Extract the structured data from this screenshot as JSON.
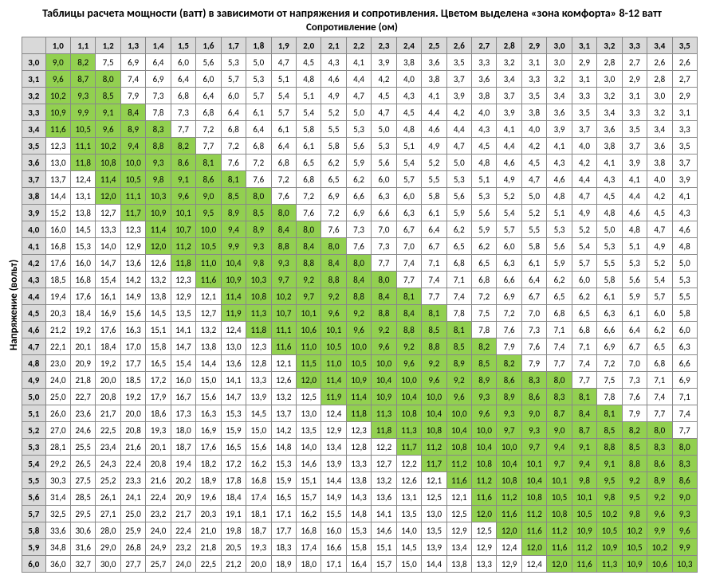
{
  "title": "Таблицы расчета мощности (ватт) в зависимоти от напряжения и сопротивления. Цветом выделена «зона комфорта» 8-12 ватт",
  "subtitle": "Сопротивление (ом)",
  "side_label": "Напряжение (вольт)",
  "comfort_min": 8.0,
  "comfort_max": 12.0,
  "chart_data": {
    "type": "table",
    "title": "Power (W) = Voltage² / Resistance",
    "xlabel": "Сопротивление (ом)",
    "ylabel": "Напряжение (вольт)",
    "resistance": [
      "1,0",
      "1,1",
      "1,2",
      "1,3",
      "1,4",
      "1,5",
      "1,6",
      "1,7",
      "1,8",
      "1,9",
      "2,0",
      "2,1",
      "2,2",
      "2,3",
      "2,4",
      "2,5",
      "2,6",
      "2,7",
      "2,8",
      "2,9",
      "3,0",
      "3,1",
      "3,2",
      "3,3",
      "3,4",
      "3,5"
    ],
    "voltage": [
      "3,0",
      "3,1",
      "3,2",
      "3,3",
      "3,4",
      "3,5",
      "3,6",
      "3,7",
      "3,8",
      "3,9",
      "4,0",
      "4,1",
      "4,2",
      "4,3",
      "4,4",
      "4,5",
      "4,6",
      "4,7",
      "4,8",
      "4,9",
      "5,0",
      "5,1",
      "5,2",
      "5,3",
      "5,4",
      "5,5",
      "5,6",
      "5,7",
      "5,8",
      "5,9",
      "6,0"
    ],
    "values": [
      [
        "9,0",
        "8,2",
        "7,5",
        "6,9",
        "6,4",
        "6,0",
        "5,6",
        "5,3",
        "5,0",
        "4,7",
        "4,5",
        "4,3",
        "4,1",
        "3,9",
        "3,8",
        "3,6",
        "3,5",
        "3,3",
        "3,2",
        "3,1",
        "3,0",
        "2,9",
        "2,8",
        "2,7",
        "2,6",
        "2,6"
      ],
      [
        "9,6",
        "8,7",
        "8,0",
        "7,4",
        "6,9",
        "6,4",
        "6,0",
        "5,7",
        "5,3",
        "5,1",
        "4,8",
        "4,6",
        "4,4",
        "4,2",
        "4,0",
        "3,8",
        "3,7",
        "3,6",
        "3,4",
        "3,3",
        "3,2",
        "3,1",
        "3,0",
        "2,9",
        "2,8",
        "2,7"
      ],
      [
        "10,2",
        "9,3",
        "8,5",
        "7,9",
        "7,3",
        "6,8",
        "6,4",
        "6,0",
        "5,7",
        "5,4",
        "5,1",
        "4,9",
        "4,7",
        "4,5",
        "4,3",
        "4,1",
        "3,9",
        "3,8",
        "3,7",
        "3,5",
        "3,4",
        "3,3",
        "3,2",
        "3,1",
        "3,0",
        "2,9"
      ],
      [
        "10,9",
        "9,9",
        "9,1",
        "8,4",
        "7,8",
        "7,3",
        "6,8",
        "6,4",
        "6,1",
        "5,7",
        "5,4",
        "5,2",
        "5,0",
        "4,7",
        "4,5",
        "4,4",
        "4,2",
        "4,0",
        "3,9",
        "3,8",
        "3,6",
        "3,5",
        "3,4",
        "3,3",
        "3,2",
        "3,1"
      ],
      [
        "11,6",
        "10,5",
        "9,6",
        "8,9",
        "8,3",
        "7,7",
        "7,2",
        "6,8",
        "6,4",
        "6,1",
        "5,8",
        "5,5",
        "5,3",
        "5,0",
        "4,8",
        "4,6",
        "4,4",
        "4,3",
        "4,1",
        "4,0",
        "3,9",
        "3,7",
        "3,6",
        "3,5",
        "3,4",
        "3,3"
      ],
      [
        "12,3",
        "11,1",
        "10,2",
        "9,4",
        "8,8",
        "8,2",
        "7,7",
        "7,2",
        "6,8",
        "6,4",
        "6,1",
        "5,8",
        "5,6",
        "5,3",
        "5,1",
        "4,9",
        "4,7",
        "4,5",
        "4,4",
        "4,2",
        "4,1",
        "4,0",
        "3,8",
        "3,7",
        "3,6",
        "3,5"
      ],
      [
        "13,0",
        "11,8",
        "10,8",
        "10,0",
        "9,3",
        "8,6",
        "8,1",
        "7,6",
        "7,2",
        "6,8",
        "6,5",
        "6,2",
        "5,9",
        "5,6",
        "5,4",
        "5,2",
        "5,0",
        "4,8",
        "4,6",
        "4,5",
        "4,3",
        "4,2",
        "4,1",
        "3,9",
        "3,8",
        "3,7"
      ],
      [
        "13,7",
        "12,4",
        "11,4",
        "10,5",
        "9,8",
        "9,1",
        "8,6",
        "8,1",
        "7,6",
        "7,2",
        "6,8",
        "6,5",
        "6,2",
        "6,0",
        "5,7",
        "5,5",
        "5,3",
        "5,1",
        "4,9",
        "4,7",
        "4,6",
        "4,4",
        "4,3",
        "4,1",
        "4,0",
        "3,9"
      ],
      [
        "14,4",
        "13,1",
        "12,0",
        "11,1",
        "10,3",
        "9,6",
        "9,0",
        "8,5",
        "8,0",
        "7,6",
        "7,2",
        "6,9",
        "6,6",
        "6,3",
        "6,0",
        "5,8",
        "5,6",
        "5,3",
        "5,2",
        "5,0",
        "4,8",
        "4,7",
        "4,5",
        "4,4",
        "4,2",
        "4,1"
      ],
      [
        "15,2",
        "13,8",
        "12,7",
        "11,7",
        "10,9",
        "10,1",
        "9,5",
        "8,9",
        "8,5",
        "8,0",
        "7,6",
        "7,2",
        "6,9",
        "6,6",
        "6,3",
        "6,1",
        "5,9",
        "5,6",
        "5,4",
        "5,2",
        "5,1",
        "4,9",
        "4,8",
        "4,6",
        "4,5",
        "4,3"
      ],
      [
        "16,0",
        "14,5",
        "13,3",
        "12,3",
        "11,4",
        "10,7",
        "10,0",
        "9,4",
        "8,9",
        "8,4",
        "8,0",
        "7,6",
        "7,3",
        "7,0",
        "6,7",
        "6,4",
        "6,2",
        "5,9",
        "5,7",
        "5,5",
        "5,3",
        "5,2",
        "5,0",
        "4,8",
        "4,7",
        "4,6"
      ],
      [
        "16,8",
        "15,3",
        "14,0",
        "12,9",
        "12,0",
        "11,2",
        "10,5",
        "9,9",
        "9,3",
        "8,8",
        "8,4",
        "8,0",
        "7,6",
        "7,3",
        "7,0",
        "6,7",
        "6,5",
        "6,2",
        "6,0",
        "5,8",
        "5,6",
        "5,4",
        "5,3",
        "5,1",
        "4,9",
        "4,8"
      ],
      [
        "17,6",
        "16,0",
        "14,7",
        "13,6",
        "12,6",
        "11,8",
        "11,0",
        "10,4",
        "9,8",
        "9,3",
        "8,8",
        "8,4",
        "8,0",
        "7,7",
        "7,4",
        "7,1",
        "6,8",
        "6,5",
        "6,3",
        "6,1",
        "5,9",
        "5,7",
        "5,5",
        "5,3",
        "5,2",
        "5,0"
      ],
      [
        "18,5",
        "16,8",
        "15,4",
        "14,2",
        "13,2",
        "12,3",
        "11,6",
        "10,9",
        "10,3",
        "9,7",
        "9,2",
        "8,8",
        "8,4",
        "8,0",
        "7,7",
        "7,4",
        "7,1",
        "6,8",
        "6,6",
        "6,4",
        "6,2",
        "6,0",
        "5,8",
        "5,6",
        "5,4",
        "5,3"
      ],
      [
        "19,4",
        "17,6",
        "16,1",
        "14,9",
        "13,8",
        "12,9",
        "12,1",
        "11,4",
        "10,8",
        "10,2",
        "9,7",
        "9,2",
        "8,8",
        "8,4",
        "8,1",
        "7,7",
        "7,4",
        "7,2",
        "6,9",
        "6,7",
        "6,5",
        "6,2",
        "6,1",
        "5,9",
        "5,7",
        "5,5"
      ],
      [
        "20,3",
        "18,4",
        "16,9",
        "15,6",
        "14,5",
        "13,5",
        "12,7",
        "11,9",
        "11,3",
        "10,7",
        "10,1",
        "9,6",
        "9,2",
        "8,8",
        "8,4",
        "8,1",
        "7,8",
        "7,5",
        "7,2",
        "7,0",
        "6,8",
        "6,5",
        "6,3",
        "6,1",
        "6,0",
        "5,8"
      ],
      [
        "21,2",
        "19,2",
        "17,6",
        "16,3",
        "15,1",
        "14,1",
        "13,2",
        "12,4",
        "11,8",
        "11,1",
        "10,6",
        "10,1",
        "9,6",
        "9,2",
        "8,8",
        "8,5",
        "8,1",
        "7,8",
        "7,6",
        "7,3",
        "7,1",
        "6,8",
        "6,6",
        "6,4",
        "6,2",
        "6,0"
      ],
      [
        "22,1",
        "20,1",
        "18,4",
        "17,0",
        "15,8",
        "14,7",
        "13,8",
        "13,0",
        "12,3",
        "11,6",
        "11,0",
        "10,5",
        "10,0",
        "9,6",
        "9,2",
        "8,8",
        "8,5",
        "8,2",
        "7,9",
        "7,6",
        "7,4",
        "7,1",
        "6,9",
        "6,7",
        "6,5",
        "6,3"
      ],
      [
        "23,0",
        "20,9",
        "19,2",
        "17,7",
        "16,5",
        "15,4",
        "14,4",
        "13,6",
        "12,8",
        "12,1",
        "11,5",
        "11,0",
        "10,5",
        "10,0",
        "9,6",
        "9,2",
        "8,9",
        "8,5",
        "8,2",
        "7,9",
        "7,7",
        "7,4",
        "7,2",
        "7,0",
        "6,8",
        "6,6"
      ],
      [
        "24,0",
        "21,8",
        "20,0",
        "18,5",
        "17,2",
        "16,0",
        "15,0",
        "14,1",
        "13,3",
        "12,6",
        "12,0",
        "11,4",
        "10,9",
        "10,4",
        "10,0",
        "9,6",
        "9,2",
        "8,9",
        "8,6",
        "8,3",
        "8,0",
        "7,7",
        "7,5",
        "7,3",
        "7,1",
        "6,9"
      ],
      [
        "25,0",
        "22,7",
        "20,8",
        "19,2",
        "17,9",
        "16,7",
        "15,6",
        "14,7",
        "13,9",
        "13,2",
        "12,5",
        "11,9",
        "11,4",
        "10,9",
        "10,4",
        "10,0",
        "9,6",
        "9,3",
        "8,9",
        "8,6",
        "8,3",
        "8,1",
        "7,8",
        "7,6",
        "7,4",
        "7,1"
      ],
      [
        "26,0",
        "23,6",
        "21,7",
        "20,0",
        "18,6",
        "17,3",
        "16,3",
        "15,3",
        "14,5",
        "13,7",
        "13,0",
        "12,4",
        "11,8",
        "11,3",
        "10,8",
        "10,4",
        "10,0",
        "9,6",
        "9,3",
        "9,0",
        "8,7",
        "8,4",
        "8,1",
        "7,9",
        "7,7",
        "7,4"
      ],
      [
        "27,0",
        "24,6",
        "22,5",
        "20,8",
        "19,3",
        "18,0",
        "16,9",
        "15,9",
        "15,0",
        "14,2",
        "13,5",
        "12,9",
        "12,3",
        "11,8",
        "11,3",
        "10,8",
        "10,4",
        "10,0",
        "9,7",
        "9,3",
        "9,0",
        "8,7",
        "8,5",
        "8,2",
        "8,0",
        "7,7"
      ],
      [
        "28,1",
        "25,5",
        "23,4",
        "21,6",
        "20,1",
        "18,7",
        "17,6",
        "16,5",
        "15,6",
        "14,8",
        "14,0",
        "13,4",
        "12,8",
        "12,2",
        "11,7",
        "11,2",
        "10,8",
        "10,4",
        "10,0",
        "9,7",
        "9,4",
        "9,1",
        "8,8",
        "8,5",
        "8,3",
        "8,0"
      ],
      [
        "29,2",
        "26,5",
        "24,3",
        "22,4",
        "20,8",
        "19,4",
        "18,2",
        "17,2",
        "16,2",
        "15,3",
        "14,6",
        "13,9",
        "13,3",
        "12,7",
        "12,2",
        "11,7",
        "11,2",
        "10,8",
        "10,4",
        "10,1",
        "9,7",
        "9,4",
        "9,1",
        "8,8",
        "8,6",
        "8,3"
      ],
      [
        "30,3",
        "27,5",
        "25,2",
        "23,3",
        "21,6",
        "20,2",
        "18,9",
        "17,8",
        "16,8",
        "15,9",
        "15,1",
        "14,4",
        "13,8",
        "13,2",
        "12,6",
        "12,1",
        "11,6",
        "11,2",
        "10,8",
        "10,4",
        "10,1",
        "9,8",
        "9,5",
        "9,2",
        "8,9",
        "8,6"
      ],
      [
        "31,4",
        "28,5",
        "26,1",
        "24,1",
        "22,4",
        "20,9",
        "19,6",
        "18,4",
        "17,4",
        "16,5",
        "15,7",
        "14,9",
        "14,3",
        "13,6",
        "13,1",
        "12,5",
        "12,1",
        "11,6",
        "11,2",
        "10,8",
        "10,5",
        "10,1",
        "9,8",
        "9,5",
        "9,2",
        "9,0"
      ],
      [
        "32,5",
        "29,5",
        "27,1",
        "25,0",
        "23,2",
        "21,7",
        "20,3",
        "19,1",
        "18,1",
        "17,1",
        "16,2",
        "15,5",
        "14,8",
        "14,1",
        "13,5",
        "13,0",
        "12,5",
        "12,0",
        "11,6",
        "11,2",
        "10,8",
        "10,5",
        "10,2",
        "9,8",
        "9,6",
        "9,3"
      ],
      [
        "33,6",
        "30,6",
        "28,0",
        "25,9",
        "24,0",
        "22,4",
        "21,0",
        "19,8",
        "18,7",
        "17,7",
        "16,8",
        "16,0",
        "15,3",
        "14,6",
        "14,0",
        "13,5",
        "12,9",
        "12,5",
        "12,0",
        "11,6",
        "11,2",
        "10,9",
        "10,5",
        "10,2",
        "9,9",
        "9,6"
      ],
      [
        "34,8",
        "31,6",
        "29,0",
        "26,8",
        "24,9",
        "23,2",
        "21,8",
        "20,5",
        "19,3",
        "18,3",
        "17,4",
        "16,6",
        "15,8",
        "15,1",
        "14,5",
        "13,9",
        "13,4",
        "12,9",
        "12,4",
        "12,0",
        "11,6",
        "11,2",
        "10,9",
        "10,5",
        "10,2",
        "9,9"
      ],
      [
        "36,0",
        "32,7",
        "30,0",
        "27,7",
        "25,7",
        "24,0",
        "22,5",
        "21,2",
        "20,0",
        "18,9",
        "18,0",
        "17,1",
        "16,4",
        "15,7",
        "15,0",
        "14,4",
        "13,8",
        "13,3",
        "12,9",
        "12,4",
        "12,0",
        "11,6",
        "11,3",
        "10,9",
        "10,6",
        "10,3"
      ]
    ]
  }
}
